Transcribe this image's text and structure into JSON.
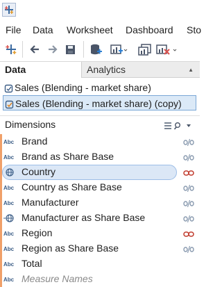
{
  "menubar": {
    "items": [
      "File",
      "Data",
      "Worksheet",
      "Dashboard",
      "Sto"
    ]
  },
  "toolbar": {
    "icons": [
      "tableau-logo-icon",
      "undo-icon",
      "redo-icon",
      "save-icon",
      "new-data-source-icon",
      "new-worksheet-icon",
      "duplicate-icon",
      "clear-icon"
    ]
  },
  "panel": {
    "tab_data": "Data",
    "tab_analytics": "Analytics"
  },
  "data_sources": [
    {
      "label": "Sales (Blending - market share)",
      "selected": false
    },
    {
      "label": "Sales (Blending - market share) (copy)",
      "selected": true
    }
  ],
  "dimensions": {
    "title": "Dimensions",
    "fields": [
      {
        "name": "Brand",
        "type": "Abc",
        "link": "broken",
        "selected": false,
        "italic": false
      },
      {
        "name": "Brand as Share Base",
        "type": "Abc",
        "link": "broken",
        "selected": false,
        "italic": false
      },
      {
        "name": "Country",
        "type": "globe",
        "link": "active",
        "selected": true,
        "italic": false
      },
      {
        "name": "Country as Share Base",
        "type": "Abc",
        "link": "broken",
        "selected": false,
        "italic": false
      },
      {
        "name": "Manufacturer",
        "type": "Abc",
        "link": "broken",
        "selected": false,
        "italic": false
      },
      {
        "name": "Manufacturer as Share Base",
        "type": "globe",
        "link": "broken",
        "selected": false,
        "italic": false
      },
      {
        "name": "Region",
        "type": "Abc",
        "link": "active",
        "selected": false,
        "italic": false
      },
      {
        "name": "Region as Share Base",
        "type": "Abc",
        "link": "broken",
        "selected": false,
        "italic": false
      },
      {
        "name": "Total",
        "type": "Abc",
        "link": "none",
        "selected": false,
        "italic": false
      },
      {
        "name": "Measure Names",
        "type": "Abc",
        "link": "none",
        "selected": false,
        "italic": true
      }
    ]
  },
  "colors": {
    "accent_bar": "#f0a069",
    "link_active": "#c0392b",
    "link_broken": "#8a9bb0",
    "selection": "#dbe7f6"
  }
}
